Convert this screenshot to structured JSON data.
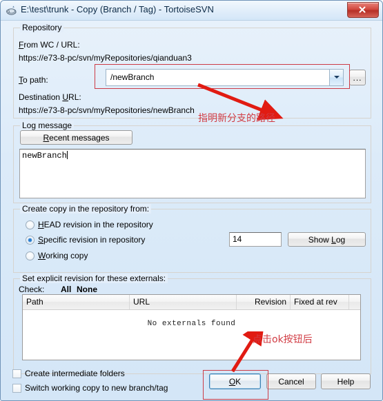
{
  "window": {
    "title": "E:\\test\\trunk - Copy (Branch / Tag) - TortoiseSVN",
    "app_icon": "tortoise-svn-icon",
    "close_label": "x"
  },
  "repository": {
    "group_label": "Repository",
    "from_label": "From WC / URL:",
    "from_url": "https://e73-8-pc/svn/myRepositories/qianduan3",
    "to_path_label": "To path:",
    "to_path_value": "/newBranch",
    "browse_label": "...",
    "destination_label": "Destination URL:",
    "destination_url": "https://e73-8-pc/svn/myRepositories/newBranch"
  },
  "log_message": {
    "group_label": "Log message",
    "recent_button": "Recent messages",
    "text": "newBranch"
  },
  "create_copy": {
    "group_label": "Create copy in the repository from:",
    "options": [
      {
        "label": "HEAD revision in the repository",
        "selected": false
      },
      {
        "label": "Specific revision in repository",
        "selected": true
      },
      {
        "label": "Working copy",
        "selected": false
      }
    ],
    "revision_value": "14",
    "show_log_button": "Show Log"
  },
  "externals": {
    "group_label": "Set explicit revision for these externals:",
    "check_label": "Check:",
    "check_all": "All",
    "check_none": "None",
    "columns": [
      "Path",
      "URL",
      "Revision",
      "Fixed at rev"
    ],
    "rows": [],
    "empty_text": "No externals found"
  },
  "footer": {
    "checkboxes": [
      {
        "label": "Create intermediate folders",
        "checked": false
      },
      {
        "label": "Switch working copy to new branch/tag",
        "checked": false
      }
    ],
    "ok_button": "OK",
    "cancel_button": "Cancel",
    "help_button": "Help"
  },
  "annotations": {
    "note_top": "指明新分支的路径",
    "note_bottom": "点击ok按钮后",
    "color": "#d13b43"
  }
}
